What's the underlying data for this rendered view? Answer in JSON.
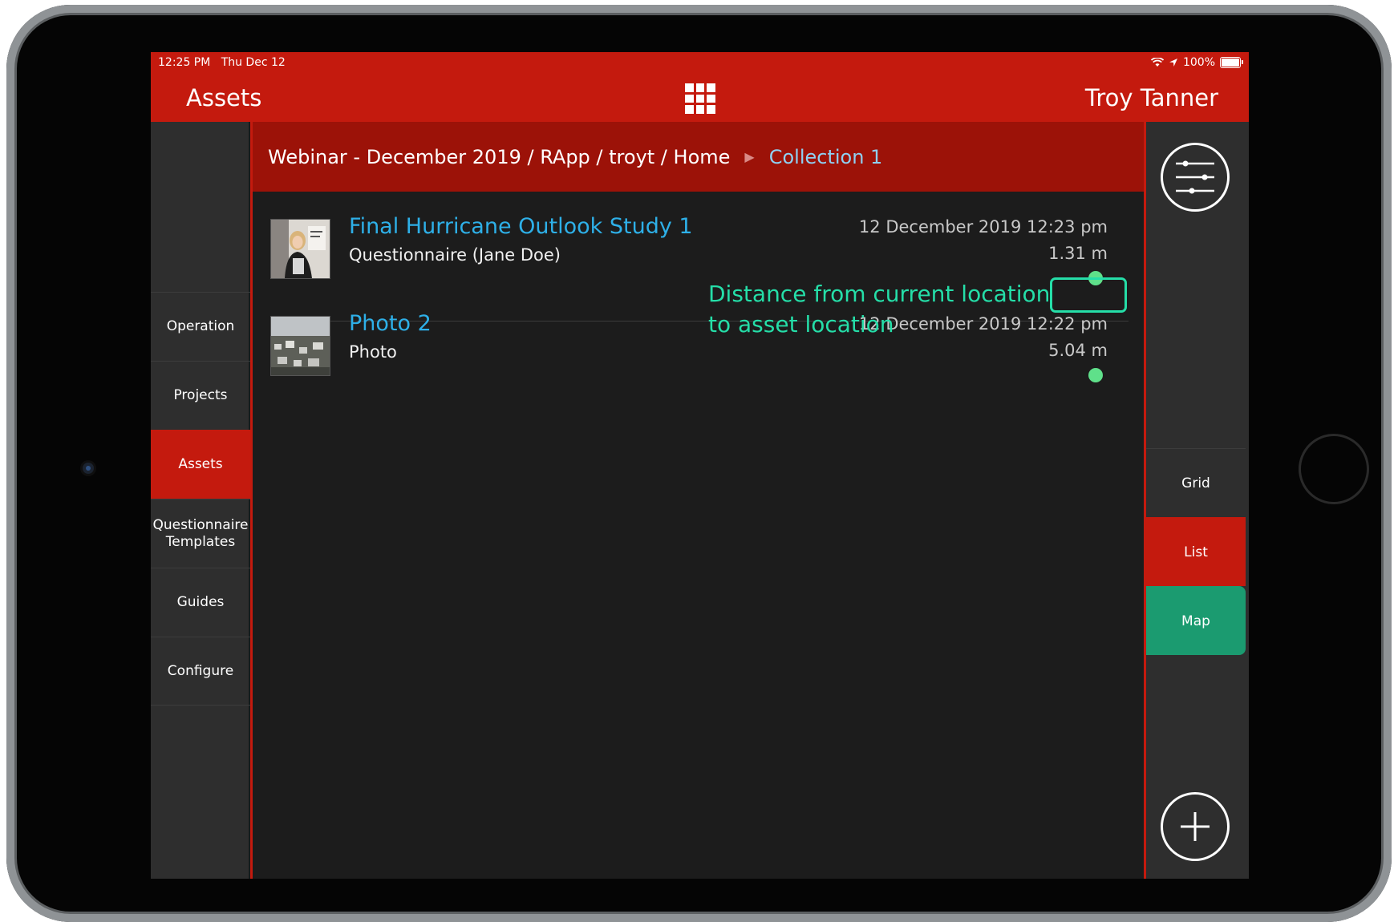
{
  "status_bar": {
    "time": "12:25 PM",
    "date": "Thu Dec 12",
    "battery": "100%"
  },
  "header": {
    "title": "Assets",
    "user": "Troy Tanner",
    "grid_icon": "grid-icon"
  },
  "sidebar": {
    "items": [
      {
        "label": "Operation",
        "active": false
      },
      {
        "label": "Projects",
        "active": false
      },
      {
        "label": "Assets",
        "active": true
      },
      {
        "label": "Questionnaire Templates",
        "active": false
      },
      {
        "label": "Guides",
        "active": false
      },
      {
        "label": "Configure",
        "active": false
      }
    ]
  },
  "breadcrumb": {
    "path": "Webinar - December 2019 / RApp / troyt / Home",
    "current": "Collection 1"
  },
  "assets": [
    {
      "name": "Final Hurricane Outlook Study 1",
      "type": "Questionnaire (Jane Doe)",
      "date": "12 December 2019 12:23 pm",
      "distance": "1.31 m",
      "status_color": "#5fe08a"
    },
    {
      "name": "Photo 2",
      "type": "Photo",
      "date": "12 December 2019 12:22 pm",
      "distance": "5.04 m",
      "status_color": "#5fe08a"
    }
  ],
  "annotation": {
    "line1": "Distance from current location",
    "line2": "to asset location",
    "color": "#25dea8"
  },
  "view_modes": [
    {
      "label": "Grid",
      "active": false
    },
    {
      "label": "List",
      "active": true
    },
    {
      "label": "Map",
      "active": false
    }
  ],
  "colors": {
    "primary_red": "#c41a0e",
    "dark_red": "#9c1208",
    "link_blue": "#2eb0e8",
    "map_green": "#1b9b70"
  }
}
